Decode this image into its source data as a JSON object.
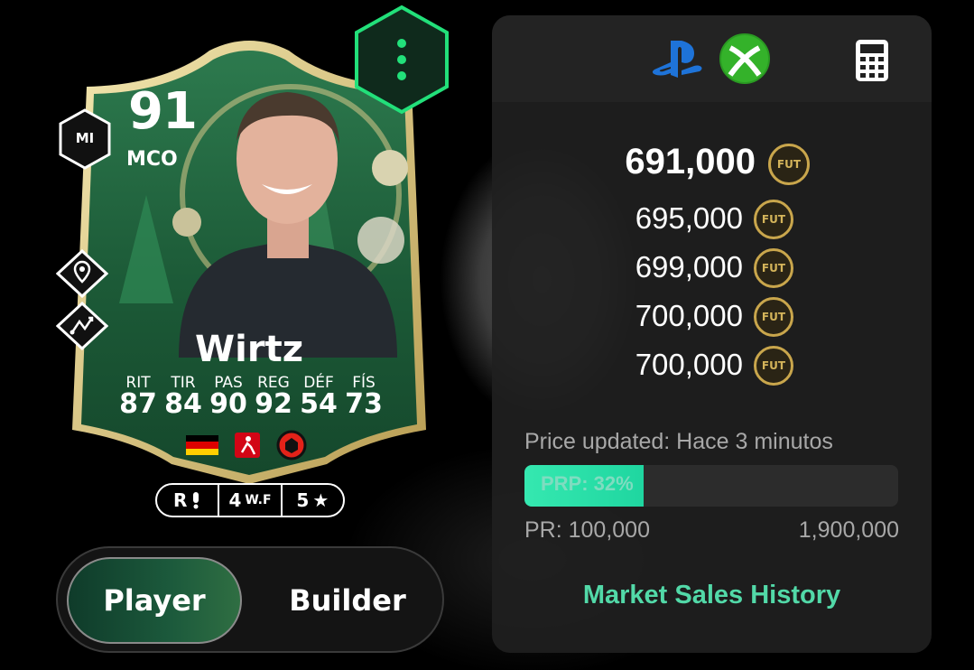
{
  "card": {
    "rating": "91",
    "position": "MCO",
    "alt_position": "MI",
    "name": "Wirtz",
    "stats": [
      {
        "label": "RIT",
        "value": "87"
      },
      {
        "label": "TIR",
        "value": "84"
      },
      {
        "label": "PAS",
        "value": "90"
      },
      {
        "label": "REG",
        "value": "92"
      },
      {
        "label": "DÉF",
        "value": "54"
      },
      {
        "label": "FÍS",
        "value": "73"
      }
    ],
    "icons": [
      "germany-flag",
      "bundesliga-logo",
      "leverkusen-crest"
    ]
  },
  "traits": {
    "skill_moves_label": "R",
    "weak_foot_value": "4",
    "weak_foot_label": "W.F",
    "stars_value": "5"
  },
  "toggle": {
    "player_label": "Player",
    "builder_label": "Builder",
    "active": "Player"
  },
  "panel": {
    "platforms": [
      "playstation-icon",
      "xbox-icon"
    ],
    "main_price": "691,000",
    "other_prices": [
      "695,000",
      "699,000",
      "700,000",
      "700,000"
    ],
    "coin_label": "FUT",
    "updated_text": "Price updated: Hace 3 minutos",
    "prp_label": "PRP: 32%",
    "prp_percent": 32,
    "pr_min": "PR: 100,000",
    "pr_max": "1,900,000",
    "market_link": "Market Sales History"
  },
  "colors": {
    "accent": "#52d9a8",
    "coin": "#c9a64c",
    "card_green": "#1f5a38",
    "card_gold": "#d9c98a"
  }
}
